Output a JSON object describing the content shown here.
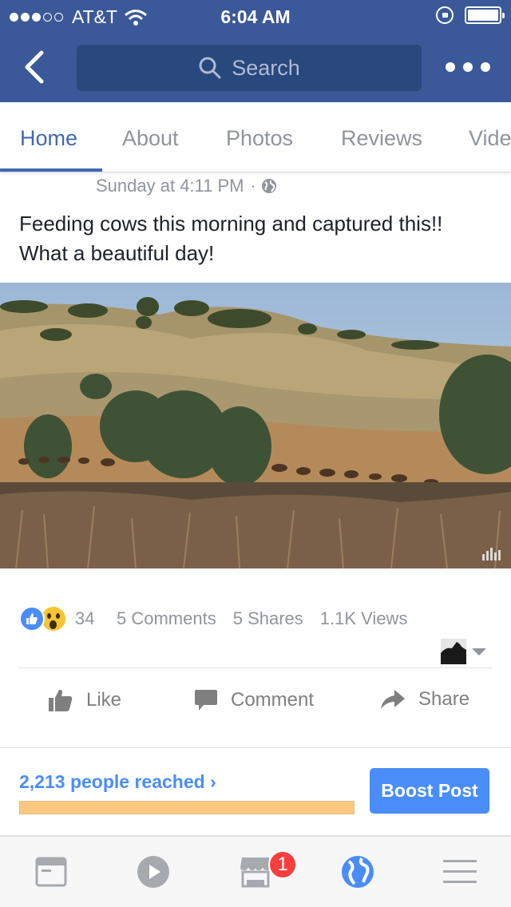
{
  "status_bar": {
    "carrier": "AT&T",
    "time": "6:04 AM",
    "signal_bars_filled": 3,
    "signal_bars_total": 5
  },
  "header": {
    "search_placeholder": "Search",
    "back_icon": "chevron-left-icon",
    "more_icon": "ellipsis-icon"
  },
  "tabs": [
    {
      "label": "Home",
      "active": true
    },
    {
      "label": "About",
      "active": false
    },
    {
      "label": "Photos",
      "active": false
    },
    {
      "label": "Reviews",
      "active": false
    },
    {
      "label": "Vide",
      "active": false
    }
  ],
  "post": {
    "timestamp": "Sunday at 4:11 PM",
    "separator": "·",
    "privacy_icon": "globe-icon",
    "text": "Feeding cows this morning and captured this!! What a beautiful day!"
  },
  "engagement": {
    "reaction_count": "34",
    "comments": "5 Comments",
    "shares": "5 Shares",
    "views": "1.1K Views"
  },
  "actions": {
    "like": "Like",
    "comment": "Comment",
    "share": "Share"
  },
  "promotion": {
    "reached_text": "2,213 people reached",
    "chevron": "›",
    "boost_label": "Boost Post",
    "progress_fraction": 1.0
  },
  "bottom_nav": {
    "items": [
      "news-feed-icon",
      "video-icon",
      "marketplace-icon",
      "globe-icon",
      "menu-icon"
    ],
    "marketplace_badge": "1"
  },
  "colors": {
    "brand": "#3b5998",
    "accent": "#4267b2",
    "link_blue": "#4a8df8",
    "badge_red": "#fa3e3e",
    "progress_orange": "#fcc880"
  }
}
